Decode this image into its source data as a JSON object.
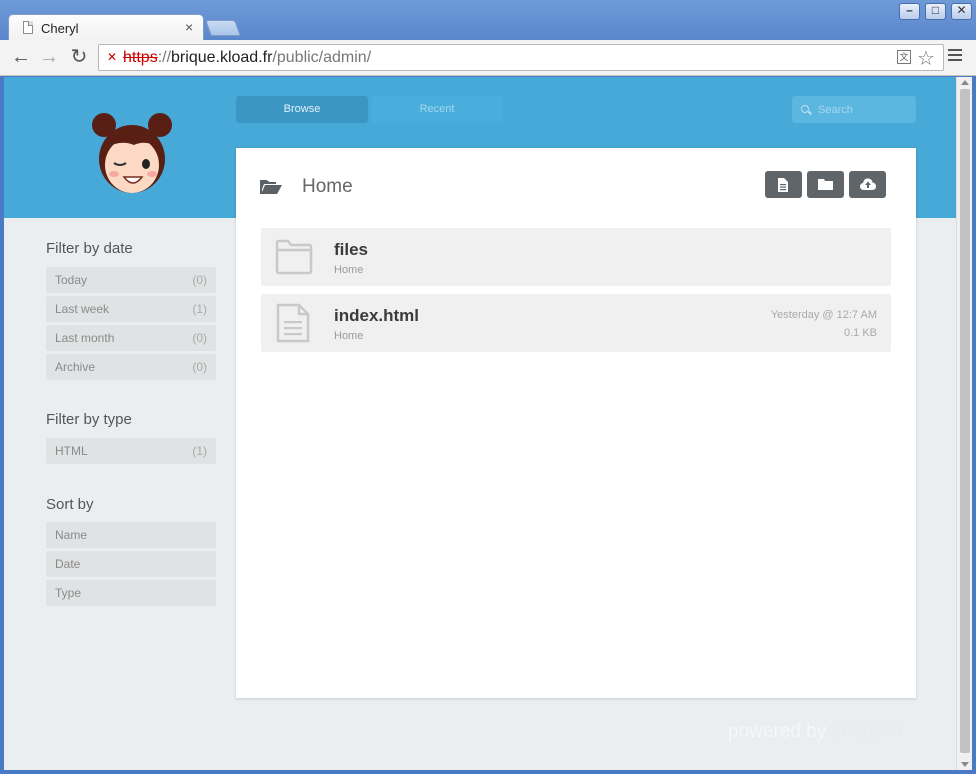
{
  "browser": {
    "tab_title": "Cheryl",
    "tab_close": "×",
    "url_scheme": "https",
    "url_sep": "://",
    "url_host": "brique.kload.fr",
    "url_path": "/public/admin/",
    "win_min": "–",
    "win_max": "□",
    "win_close": "✕",
    "back": "←",
    "forward": "→",
    "reload": "↻",
    "star": "☆"
  },
  "nav": {
    "browse": "Browse",
    "recent": "Recent",
    "search_placeholder": "Search"
  },
  "sidebar": {
    "filter_date_title": "Filter by date",
    "date_items": [
      {
        "label": "Today",
        "count": "(0)"
      },
      {
        "label": "Last week",
        "count": "(1)"
      },
      {
        "label": "Last month",
        "count": "(0)"
      },
      {
        "label": "Archive",
        "count": "(0)"
      }
    ],
    "filter_type_title": "Filter by type",
    "type_items": [
      {
        "label": "HTML",
        "count": "(1)"
      }
    ],
    "sort_title": "Sort by",
    "sort_items": [
      {
        "label": "Name"
      },
      {
        "label": "Date"
      },
      {
        "label": "Type"
      }
    ]
  },
  "main": {
    "title": "Home",
    "files": [
      {
        "name": "files",
        "location": "Home",
        "icon": "folder-icon",
        "date": "",
        "size": ""
      },
      {
        "name": "index.html",
        "location": "Home",
        "icon": "file-icon",
        "date": "Yesterday @ 12:7 AM",
        "size": "0.1 KB"
      }
    ]
  },
  "footer": {
    "powered_by": "powered by",
    "brand": "cheryl.io"
  },
  "colors": {
    "banner": "#46a9d7",
    "accent_dark": "#3b96c4",
    "button_dark": "#5f6569",
    "page_bg": "#ebeef1"
  }
}
